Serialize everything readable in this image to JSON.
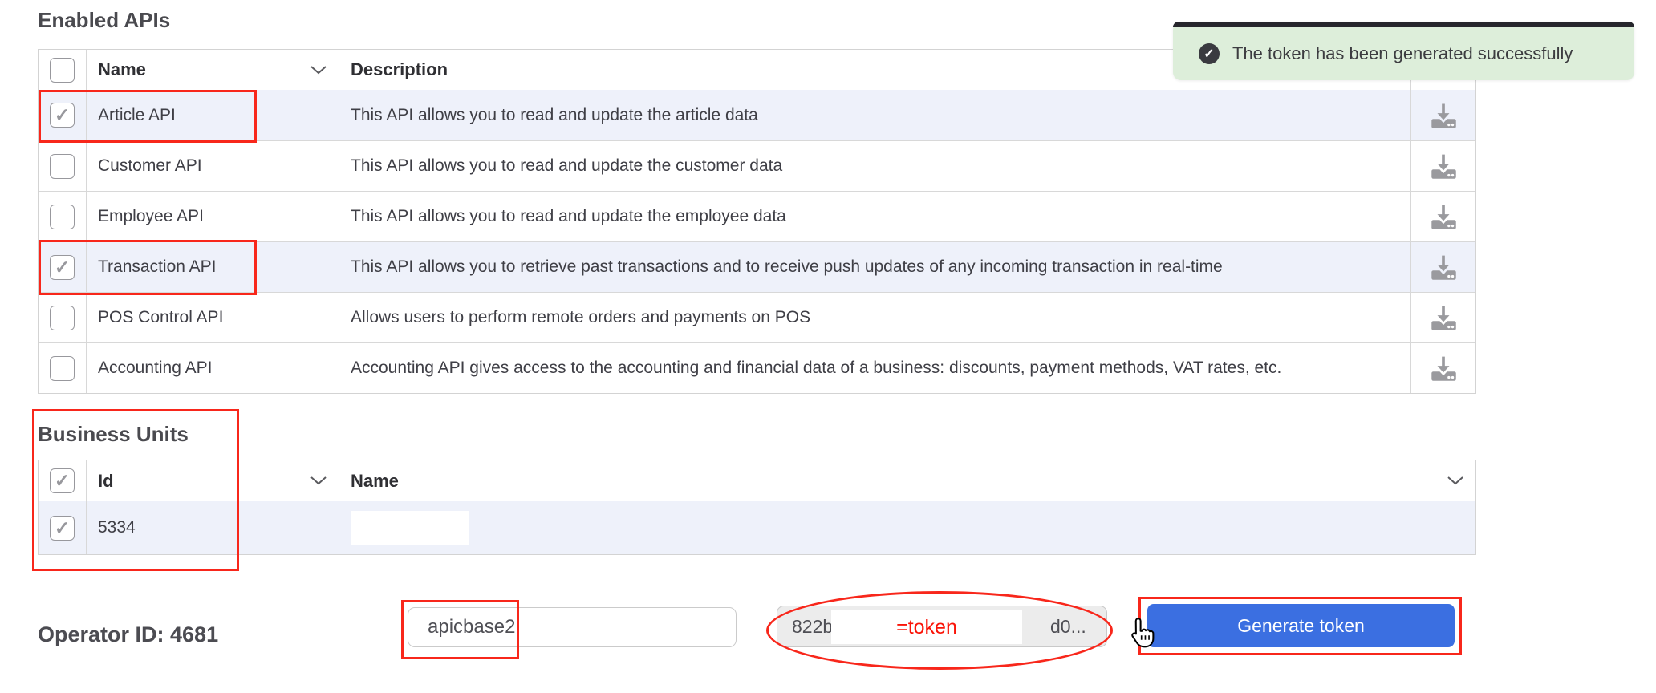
{
  "enabled_apis": {
    "title": "Enabled APIs",
    "columns": {
      "name": "Name",
      "description": "Description"
    },
    "rows": [
      {
        "name": "Article API",
        "description": "This API allows you to read and update the article data",
        "checked": true,
        "highlighted": true
      },
      {
        "name": "Customer API",
        "description": "This API allows you to read and update the customer data",
        "checked": false,
        "highlighted": false
      },
      {
        "name": "Employee API",
        "description": "This API allows you to read and update the employee data",
        "checked": false,
        "highlighted": false
      },
      {
        "name": "Transaction API",
        "description": "This API allows you to retrieve past transactions and to receive push updates of any incoming transaction in real-time",
        "checked": true,
        "highlighted": true
      },
      {
        "name": "POS Control API",
        "description": "Allows users to perform remote orders and payments on POS",
        "checked": false,
        "highlighted": false
      },
      {
        "name": "Accounting API",
        "description": "Accounting API gives access to the accounting and financial data of a business: discounts, payment methods, VAT rates, etc.",
        "checked": false,
        "highlighted": false
      }
    ]
  },
  "business_units": {
    "title": "Business Units",
    "columns": {
      "id": "Id",
      "name": "Name"
    },
    "header_checked": true,
    "rows": [
      {
        "id": "5334",
        "name": "",
        "checked": true,
        "highlighted": true,
        "name_redacted": true
      }
    ]
  },
  "footer": {
    "operator_label": "Operator ID: 4681",
    "token_name_value": "apicbase2",
    "token_prefix": "822b",
    "token_overlay_label": "=token",
    "token_suffix": "d0...",
    "generate_button_label": "Generate token"
  },
  "toast": {
    "message": "The token has been generated successfully"
  },
  "icons": {
    "checkbox_check": "✓",
    "toast_check": "✓",
    "download_icon_name": "download-icon",
    "chevron_icon_name": "chevron-down-icon"
  },
  "colors": {
    "accent_blue": "#3b6fe1",
    "annotation_red": "#f8271b",
    "row_highlight": "#eef1fa",
    "toast_green": "#ddeeda",
    "toast_bar": "#26262c",
    "icon_gray": "#9a9a9e"
  }
}
